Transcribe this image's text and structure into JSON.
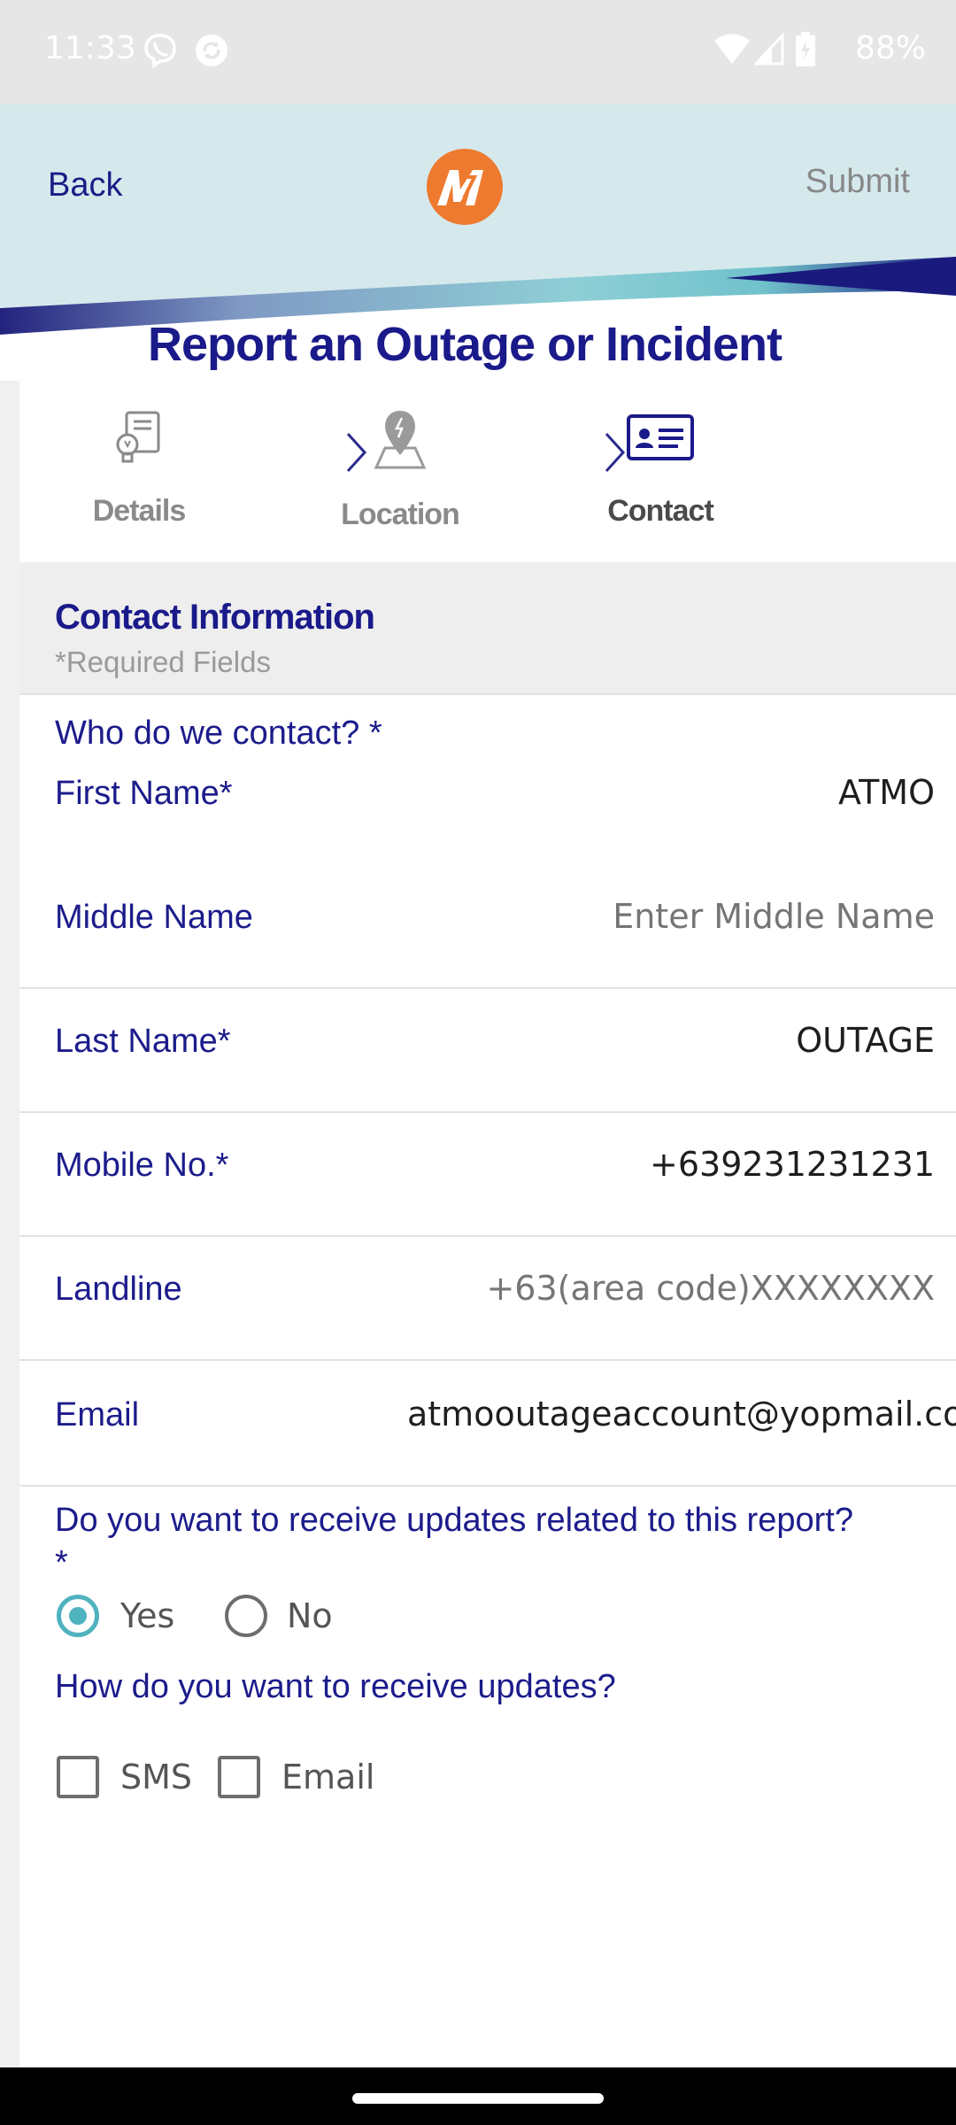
{
  "status_bar": {
    "time": "11:33",
    "battery": "88%",
    "icons": [
      "viber-icon",
      "sync-icon",
      "wifi-icon",
      "signal-icon",
      "battery-icon"
    ]
  },
  "header": {
    "back_label": "Back",
    "submit_label": "Submit",
    "logo": "meralco-logo",
    "title": "Report an Outage or Incident",
    "colors": {
      "band": "#d5e9ed",
      "navy": "#1a1a8a",
      "teal": "#4fb3bf",
      "logo_orange": "#ee7a2f"
    }
  },
  "steps": [
    {
      "label": "Details",
      "icon": "document-bulb-icon",
      "active": false
    },
    {
      "label": "Location",
      "icon": "map-pin-icon",
      "active": false
    },
    {
      "label": "Contact",
      "icon": "id-card-icon",
      "active": true
    }
  ],
  "section": {
    "title": "Contact Information",
    "subtitle": "*Required Fields"
  },
  "form": {
    "who_label": "Who do we contact? *",
    "first_name": {
      "label": "First Name*",
      "value": "ATMO",
      "placeholder": ""
    },
    "middle_name": {
      "label": "Middle Name",
      "value": "",
      "placeholder": "Enter Middle Name"
    },
    "last_name": {
      "label": "Last Name*",
      "value": "OUTAGE",
      "placeholder": ""
    },
    "mobile": {
      "label": "Mobile No.*",
      "value": "+639231231231",
      "placeholder": ""
    },
    "landline": {
      "label": "Landline",
      "value": "",
      "placeholder": "+63(area code)XXXXXXXX"
    },
    "email": {
      "label": "Email",
      "value": "atmooutageaccount@yopmail.co",
      "placeholder": ""
    }
  },
  "updates": {
    "question": "Do you want to receive updates related to this report?",
    "required_mark": "*",
    "options": [
      {
        "label": "Yes",
        "selected": true
      },
      {
        "label": "No",
        "selected": false
      }
    ],
    "method_question": "How do you want to receive updates?",
    "methods": [
      {
        "label": "SMS",
        "checked": false
      },
      {
        "label": "Email",
        "checked": false
      }
    ]
  }
}
